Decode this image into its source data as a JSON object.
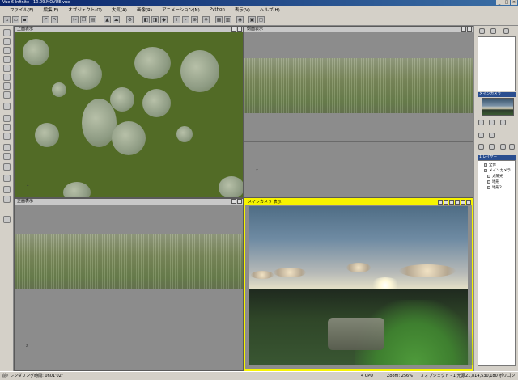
{
  "app": {
    "title": "Vue 6 Infinite - 10.09.MOVUE.vue"
  },
  "window_controls": {
    "minimize": "_",
    "maximize": "□",
    "close": "×"
  },
  "menu": [
    "ファイル(F)",
    "編集(E)",
    "オブジェクト(O)",
    "大気(A)",
    "画像(R)",
    "アニメーション(N)",
    "Python",
    "表示(V)",
    "ヘルプ(H)"
  ],
  "viewports": {
    "top": {
      "title": "上面表示",
      "axis": "z"
    },
    "side": {
      "title": "側面表示",
      "axis": "z"
    },
    "front": {
      "title": "正面表示",
      "axis": "z"
    },
    "camera": {
      "title": "メインカメラ 表示"
    }
  },
  "right_panel": {
    "camera_title": "メインカメラ",
    "layers_title": "1 レイヤー",
    "layers": [
      "全体",
      "メインカメラ",
      "太陽光",
      "地形",
      "地形2"
    ]
  },
  "status": {
    "left": "前ﾄ レンダリング時間: 0h01'02\"",
    "fps": "4 CPU",
    "zoom": "Zoom: 256%",
    "objects": "3 オブジェクト - 1 光源",
    "polygons": "21,814,530,180 ポリゴン"
  }
}
